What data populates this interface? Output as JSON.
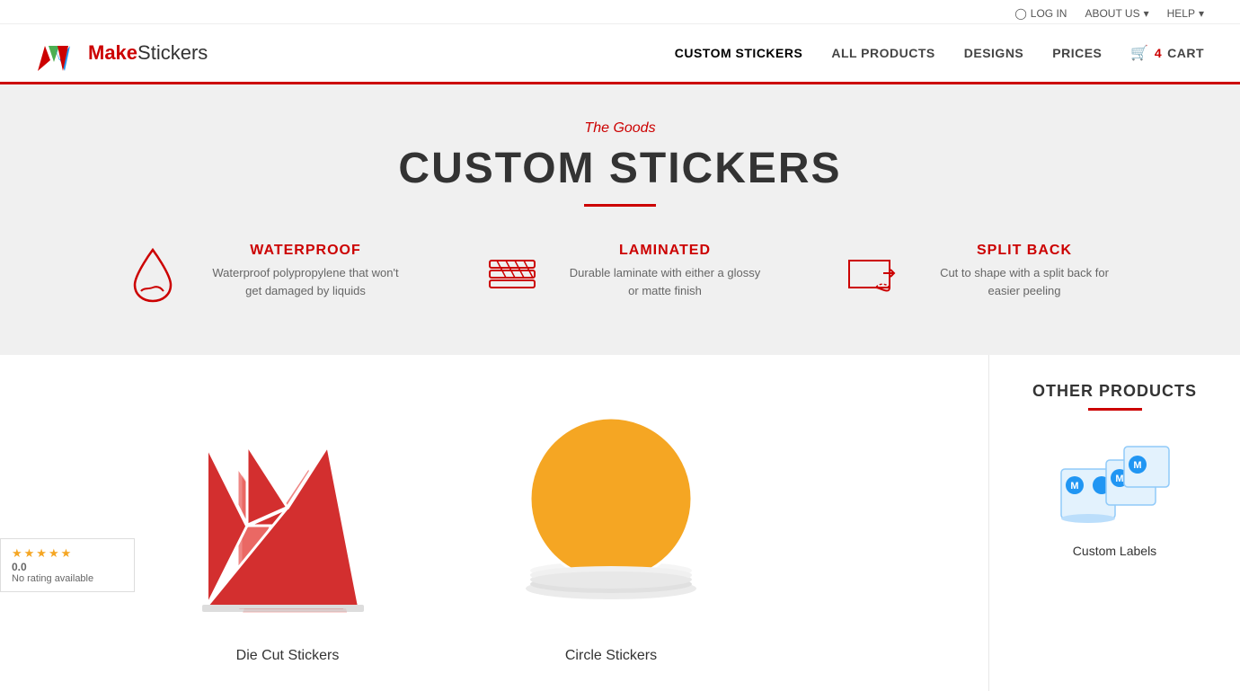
{
  "topbar": {
    "login": "LOG IN",
    "about": "ABOUT US",
    "help": "HELP"
  },
  "header": {
    "logo_make": "Make",
    "logo_stickers": "Stickers",
    "nav": [
      {
        "label": "CUSTOM STICKERS",
        "active": true
      },
      {
        "label": "ALL PRODUCTS",
        "active": false
      },
      {
        "label": "DESIGNS",
        "active": false
      },
      {
        "label": "PRICES",
        "active": false
      },
      {
        "label": "CART",
        "active": false,
        "icon": "cart-icon",
        "count": "4"
      }
    ]
  },
  "hero": {
    "subtitle": "The Goods",
    "title": "CUSTOM STICKERS"
  },
  "features": [
    {
      "id": "waterproof",
      "title": "WATERPROOF",
      "description": "Waterproof polypropylene that won't get damaged by liquids"
    },
    {
      "id": "laminated",
      "title": "LAMINATED",
      "description": "Durable laminate with either a glossy or matte finish"
    },
    {
      "id": "split-back",
      "title": "SPLIT BACK",
      "description": "Cut to shape with a split back for easier peeling"
    }
  ],
  "products": [
    {
      "id": "die-cut",
      "name": "Die Cut Stickers"
    },
    {
      "id": "circle",
      "name": "Circle Stickers"
    }
  ],
  "sidebar": {
    "title": "OTHER PRODUCTS",
    "items": [
      {
        "name": "Custom Labels"
      }
    ]
  },
  "rating": {
    "score": "0.0",
    "label": "No rating available"
  },
  "accent_color": "#cc0000"
}
